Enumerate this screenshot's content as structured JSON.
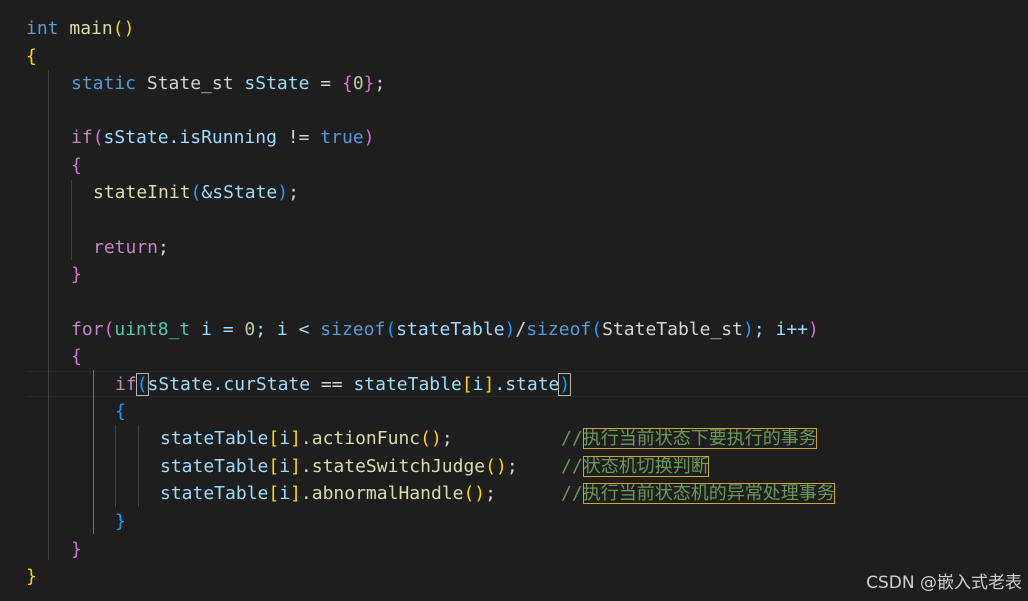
{
  "code": {
    "line_main": {
      "kw": "int",
      "name": "main",
      "open": "(",
      "close": ")"
    },
    "brace_open_main": "{",
    "line_static": {
      "kw": "static",
      "type": "State_st",
      "var": "sState",
      "eq": " = ",
      "lb": "{",
      "num": "0",
      "rb": "}",
      "semi": ";"
    },
    "line_if1": {
      "kw": "if",
      "lp": "(",
      "expr": "sState.isRunning",
      "op": " != ",
      "val": "true",
      "rp": ")"
    },
    "brace_open_if1": "{",
    "line_init": {
      "fn": "stateInit",
      "lp": "(",
      "arg": "&sState",
      "rp": ")",
      "semi": ";"
    },
    "line_return": {
      "kw": "return",
      "semi": ";"
    },
    "brace_close_if1": "}",
    "line_for": {
      "kw": "for",
      "lp": "(",
      "type": "uint8_t",
      "init": " i = ",
      "zero": "0",
      "cond": "; i < ",
      "sizeof1": "sizeof",
      "lp2": "(",
      "arr": "stateTable",
      "rp2": ")",
      "slash": "/",
      "sizeof2": "sizeof",
      "lp3": "(",
      "type2": "StateTable_st",
      "rp3": ")",
      "inc": "; i++",
      "rp": ")"
    },
    "brace_open_for": "{",
    "line_if2": {
      "kw": "if",
      "lp": "(",
      "lhs": "sState.curState",
      "op": " == ",
      "arr": "stateTable",
      "lb": "[",
      "idx": "i",
      "rb": "]",
      "field": ".state",
      "rp": ")"
    },
    "brace_open_if2": "{",
    "calls": [
      {
        "arr": "stateTable",
        "lb": "[",
        "idx": "i",
        "rb": "]",
        "dot": ".",
        "fn": "actionFunc",
        "paren": "()",
        "semi": ";",
        "pad": "          ",
        "slashes": "//",
        "comment": "执行当前状态下要执行的事务"
      },
      {
        "arr": "stateTable",
        "lb": "[",
        "idx": "i",
        "rb": "]",
        "dot": ".",
        "fn": "stateSwitchJudge",
        "paren": "()",
        "semi": ";",
        "pad": "    ",
        "slashes": "//",
        "comment": "状态机切换判断"
      },
      {
        "arr": "stateTable",
        "lb": "[",
        "idx": "i",
        "rb": "]",
        "dot": ".",
        "fn": "abnormalHandle",
        "paren": "()",
        "semi": ";",
        "pad": "      ",
        "slashes": "//",
        "comment": "执行当前状态机的异常处理事务"
      }
    ],
    "brace_close_if2": "}",
    "brace_close_for": "}",
    "brace_close_main": "}"
  },
  "watermark": "CSDN @嵌入式老表",
  "colors": {
    "background": "#1e1e1e",
    "keyword": "#569cd6",
    "control": "#c586c0",
    "function": "#dcdcaa",
    "variable": "#9cdcfe",
    "type": "#4ec9b0",
    "number": "#b5cea8",
    "comment": "#6a9955",
    "bracket_gold": "#ffd700",
    "bracket_orchid": "#da70d6",
    "bracket_blue": "#179fff"
  }
}
